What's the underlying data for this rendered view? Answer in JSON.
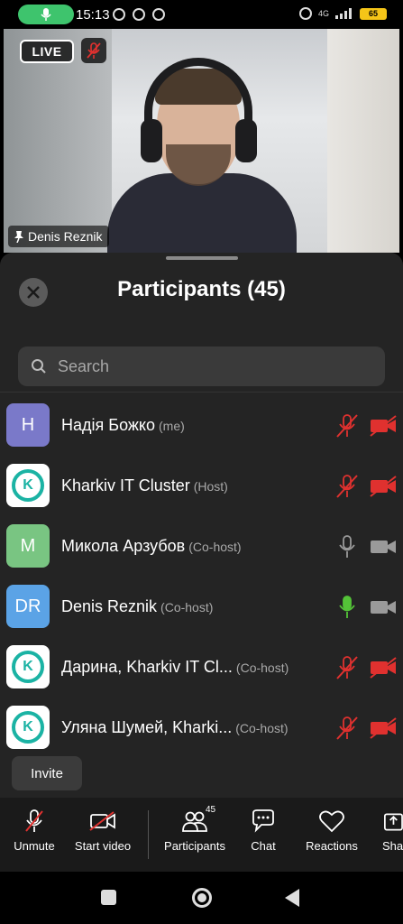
{
  "status_bar": {
    "time": "15:13",
    "signal": "4G",
    "battery": "65"
  },
  "video": {
    "live_label": "LIVE",
    "speaker_name": "Denis Reznik"
  },
  "participants_panel": {
    "title": "Participants (45)",
    "search_placeholder": "Search",
    "invite_label": "Invite",
    "participants": [
      {
        "initials": "Н",
        "avatar_color": "#7a79c9",
        "name": "Надія Божко",
        "role": "(me)",
        "mic": "muted",
        "video": "off"
      },
      {
        "initials": "K",
        "avatar_color": "cluster",
        "name": "Kharkiv IT Cluster",
        "role": "(Host)",
        "mic": "muted",
        "video": "off"
      },
      {
        "initials": "M",
        "avatar_color": "#79c582",
        "name": "Микола Арзубов",
        "role": "(Co-host)",
        "mic": "idle",
        "video": "idle"
      },
      {
        "initials": "DR",
        "avatar_color": "#5ba3e6",
        "name": "Denis Reznik",
        "role": "(Co-host)",
        "mic": "speaking",
        "video": "idle"
      },
      {
        "initials": "K",
        "avatar_color": "cluster",
        "name": "Дарина, Kharkiv IT Cl...",
        "role": "(Co-host)",
        "mic": "muted",
        "video": "off"
      },
      {
        "initials": "K",
        "avatar_color": "cluster",
        "name": "Уляна Шумей, Kharki...",
        "role": "(Co-host)",
        "mic": "muted",
        "video": "off"
      }
    ]
  },
  "toolbar": {
    "unmute": "Unmute",
    "start_video": "Start video",
    "participants": "Participants",
    "participants_count": "45",
    "chat": "Chat",
    "reactions": "Reactions",
    "share": "Sha"
  },
  "colors": {
    "muted_red": "#e0312f",
    "speaking_green": "#54c338",
    "idle_gray": "#9a9a9a",
    "sheet_bg": "#242424"
  }
}
